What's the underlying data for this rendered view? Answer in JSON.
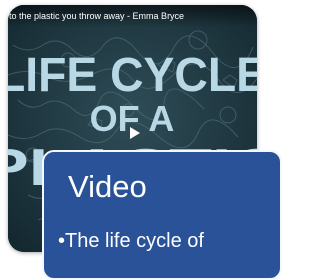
{
  "video": {
    "title": "to the plastic you throw away - Emma Bryce",
    "thumbnail_headline": [
      "LIFE CYCLE",
      "OF A",
      "PLASTIC"
    ],
    "play_icon": "play-icon"
  },
  "slide": {
    "title": "Video",
    "bullet": "The life cycle of"
  },
  "colors": {
    "thumbnail_background": "#1f3640",
    "thumbnail_letters": "#b8d8e6",
    "card_background": "#2a5298",
    "card_border": "#f4f7fb"
  }
}
